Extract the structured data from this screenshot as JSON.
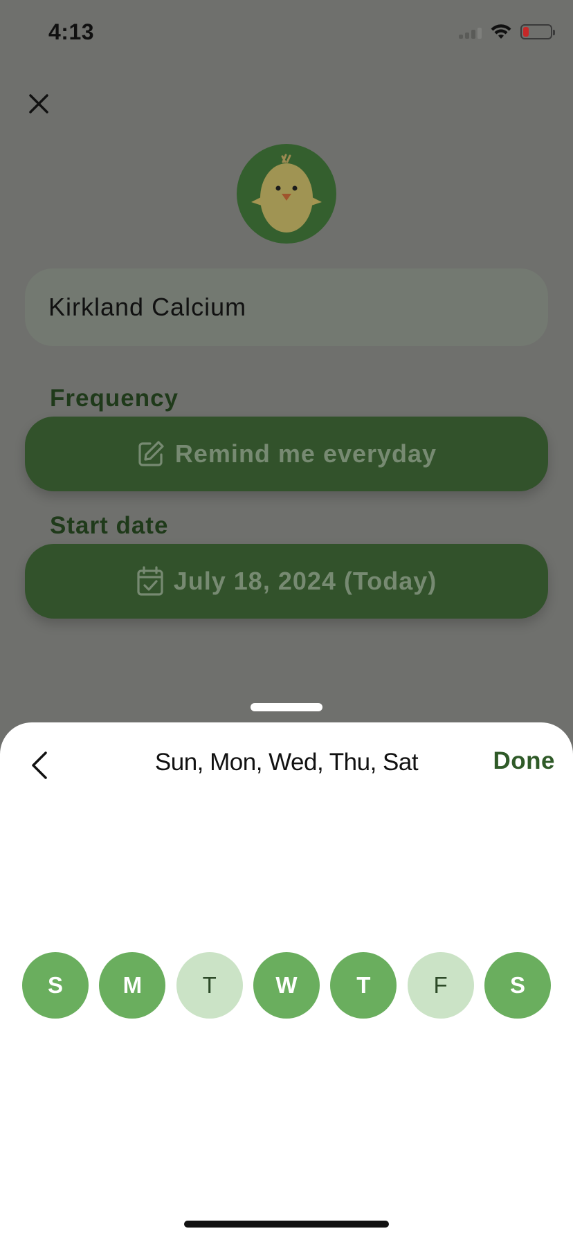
{
  "status_bar": {
    "time": "4:13",
    "battery_level": 0.2
  },
  "form": {
    "medication_name": "Kirkland Calcium",
    "frequency_label": "Frequency",
    "frequency_value": "Remind me everyday",
    "start_date_label": "Start date",
    "start_date_value": "July 18, 2024 (Today)"
  },
  "sheet": {
    "title": "Sun, Mon, Wed, Thu, Sat",
    "done_label": "Done",
    "days": [
      {
        "letter": "S",
        "selected": true
      },
      {
        "letter": "M",
        "selected": true
      },
      {
        "letter": "T",
        "selected": false
      },
      {
        "letter": "W",
        "selected": true
      },
      {
        "letter": "T",
        "selected": true
      },
      {
        "letter": "F",
        "selected": false
      },
      {
        "letter": "S",
        "selected": true
      }
    ]
  },
  "colors": {
    "overlay": "#6f706d",
    "pill": "#32522b",
    "day_selected": "#6aae5e",
    "day_unselected": "#cbe3c6",
    "done": "#2f5a28"
  },
  "icons": [
    "close-icon",
    "chick-icon",
    "edit-icon",
    "calendar-check-icon",
    "chevron-left-icon",
    "wifi-icon",
    "battery-icon",
    "signal-icon"
  ]
}
